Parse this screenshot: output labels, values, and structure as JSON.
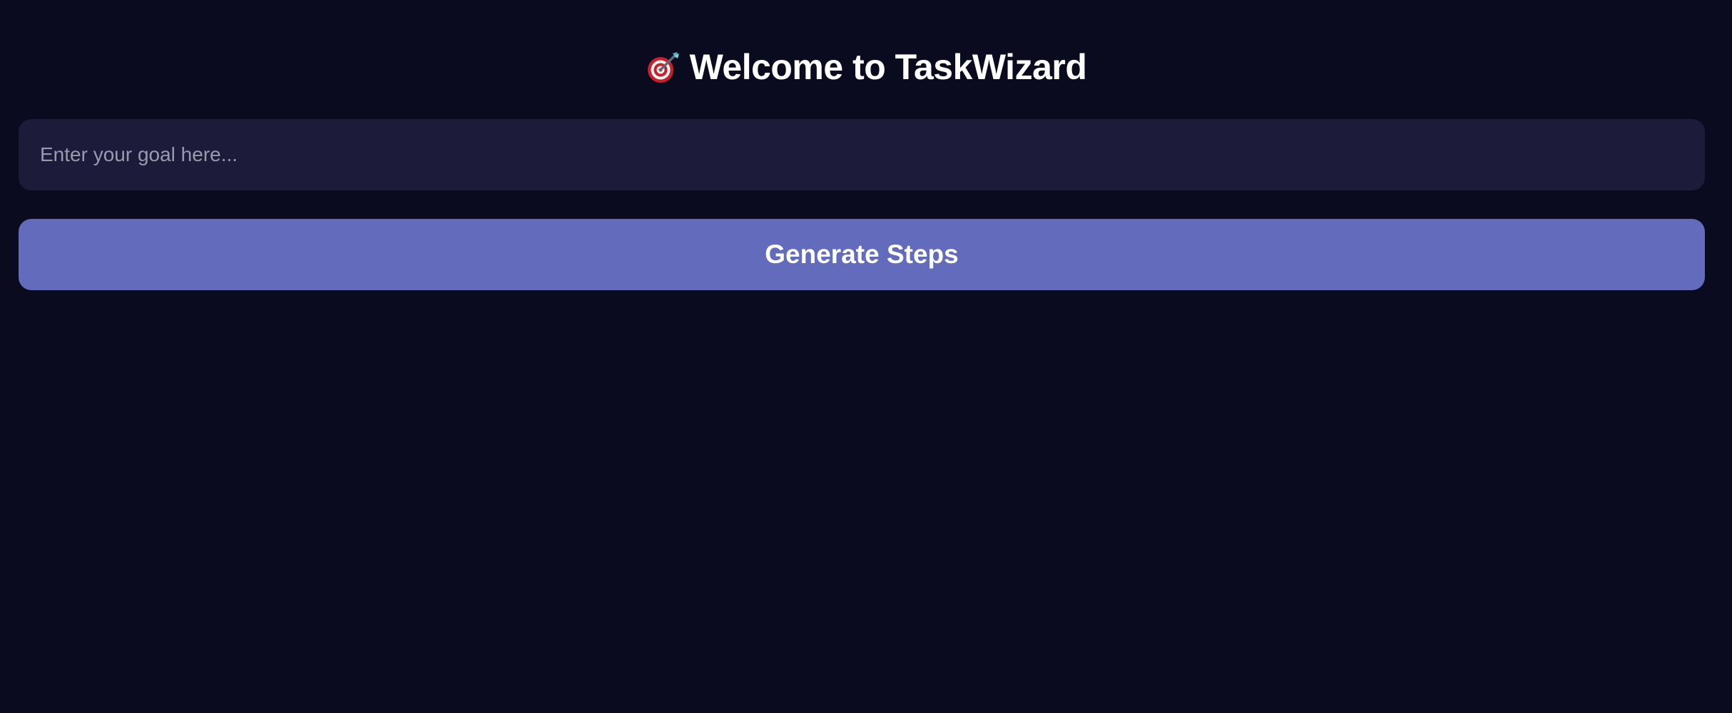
{
  "header": {
    "icon": "target-dart-icon",
    "title": "Welcome to TaskWizard"
  },
  "goal_input": {
    "value": "",
    "placeholder": "Enter your goal here..."
  },
  "generate_button": {
    "label": "Generate Steps"
  },
  "colors": {
    "background": "#0a0b1f",
    "input_background": "#1c1c3a",
    "button_background": "#636bbd",
    "text": "#ffffff",
    "placeholder": "#9a9aae"
  }
}
